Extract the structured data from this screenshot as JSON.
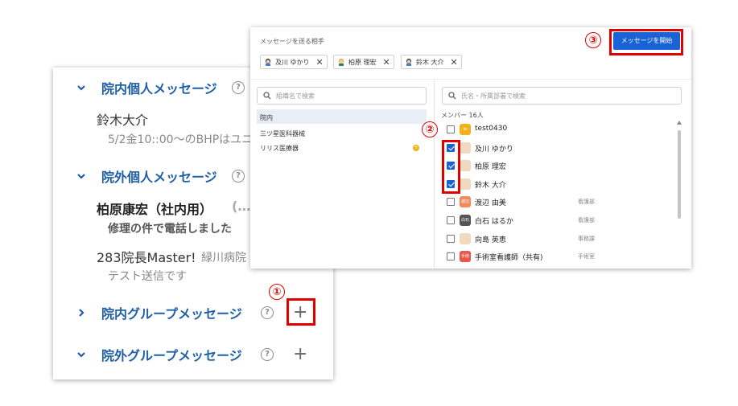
{
  "left_panel": {
    "sections": [
      {
        "title": "院内個人メッセージ",
        "expanded": true
      },
      {
        "title": "院外個人メッセージ",
        "expanded": true
      },
      {
        "title": "院内グループメッセージ",
        "expanded": false
      },
      {
        "title": "院外グループメッセージ",
        "expanded": true
      }
    ],
    "messages": [
      {
        "name": "鈴木大介",
        "preview": "5/2金10::00〜のBHPはユニ"
      },
      {
        "name": "柏原康宏（社内用）",
        "tail": "(…",
        "preview": "修理の件で電話しました"
      },
      {
        "name": "283院長Master!",
        "org": "緑川病院",
        "preview": "テスト送信です"
      }
    ],
    "help_glyph": "?",
    "add_glyph": "+"
  },
  "markers": {
    "m1": "①",
    "m2": "②",
    "m3": "③"
  },
  "dialog": {
    "recipients_label": "メッセージを送る相手",
    "recipients": [
      {
        "name": "及川 ゆかり"
      },
      {
        "name": "柏原 理宏"
      },
      {
        "name": "鈴木 大介"
      }
    ],
    "chip_close": "✕",
    "start_button": "メッセージを開始",
    "org_search_placeholder": "組織名で検索",
    "member_search_placeholder": "氏名・所属部署で検索",
    "orgs": [
      {
        "name": "院内",
        "selected": true
      },
      {
        "name": "三ツ星医科器械",
        "selected": false
      },
      {
        "name": "リリス医療器",
        "selected": false,
        "badge": "+"
      }
    ],
    "member_count_label": "メンバー 16人",
    "members": [
      {
        "name": "test0430",
        "dept": "",
        "checked": false,
        "avatar_color": "#f3b21b",
        "avatar_text": "te"
      },
      {
        "name": "及川 ゆかり",
        "dept": "",
        "checked": true,
        "avatar_color": "#f1d9c0",
        "avatar_text": ""
      },
      {
        "name": "柏原 理宏",
        "dept": "",
        "checked": true,
        "avatar_color": "#f1d9c0",
        "avatar_text": ""
      },
      {
        "name": "鈴木 大介",
        "dept": "",
        "checked": true,
        "avatar_color": "#f1d9c0",
        "avatar_text": ""
      },
      {
        "name": "渡辺 由美",
        "dept": "看護部",
        "checked": false,
        "avatar_color": "#f08a5d",
        "avatar_text": "渡辺"
      },
      {
        "name": "白石 はるか",
        "dept": "看護部",
        "checked": false,
        "avatar_color": "#555555",
        "avatar_text": "白石"
      },
      {
        "name": "向島 英恵",
        "dept": "事務課",
        "checked": false,
        "avatar_color": "#f1d9c0",
        "avatar_text": ""
      },
      {
        "name": "手術室看護師（共有)",
        "dept": "手術室",
        "checked": false,
        "avatar_color": "#e8594a",
        "avatar_text": "手術室"
      }
    ],
    "colors": {
      "primary": "#1a63d6",
      "accent_red": "#e00000",
      "section_blue": "#1f5fa8"
    }
  }
}
